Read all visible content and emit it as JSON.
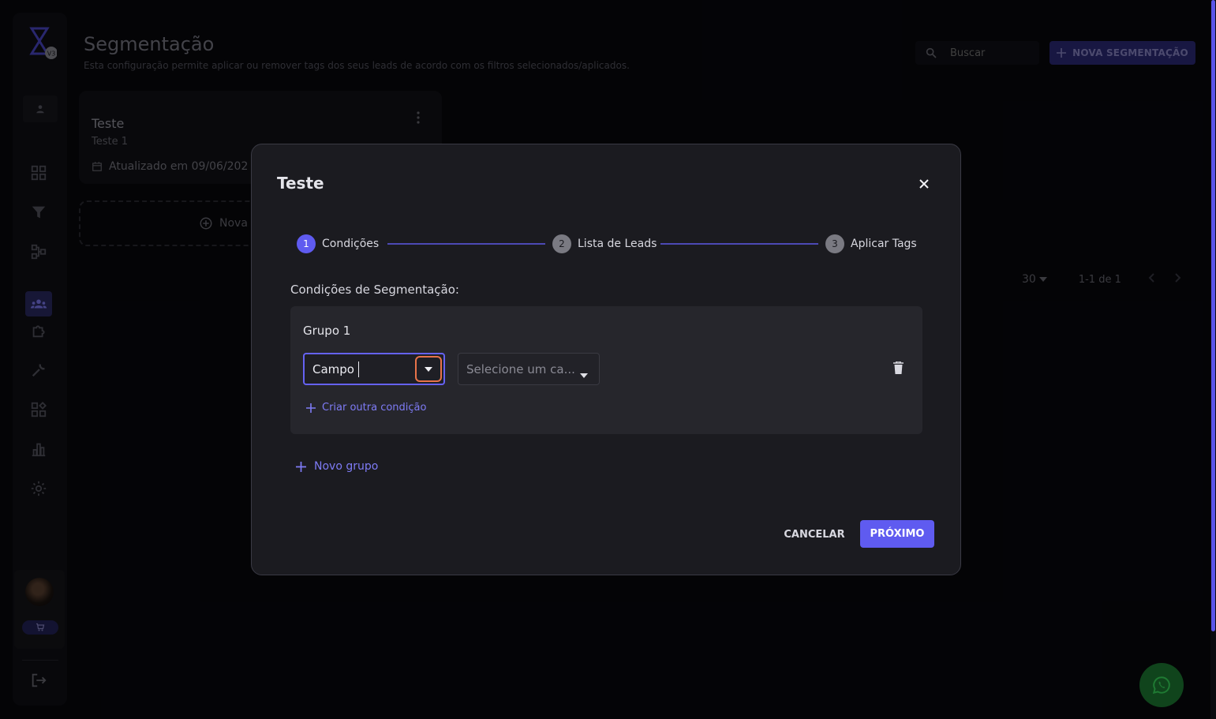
{
  "header": {
    "title": "Segmentação",
    "description": "Esta configuração permite aplicar ou remover tags dos seus leads de acordo com os filtros selecionados/aplicados.",
    "search_placeholder": "Buscar",
    "new_button": "NOVA SEGMENTAÇÃO"
  },
  "sidebar": {
    "logo_badge": "V3",
    "items": [
      {
        "icon": "dashboard-icon"
      },
      {
        "icon": "filter-icon"
      },
      {
        "icon": "flow-icon"
      },
      {
        "icon": "segmentation-icon",
        "active": true
      },
      {
        "icon": "puzzle-icon"
      },
      {
        "icon": "wrench-icon"
      },
      {
        "icon": "apps-icon"
      },
      {
        "icon": "chart-icon"
      },
      {
        "icon": "gear-icon"
      }
    ]
  },
  "card": {
    "title": "Teste",
    "subtitle": "Teste 1",
    "updated": "Atualizado em 09/06/202",
    "new_label": "Nova s"
  },
  "pagination": {
    "per_page": "30",
    "range": "1-1 de 1"
  },
  "modal": {
    "title": "Teste",
    "steps": [
      {
        "num": "1",
        "label": "Condições"
      },
      {
        "num": "2",
        "label": "Lista de Leads"
      },
      {
        "num": "3",
        "label": "Aplicar Tags"
      }
    ],
    "conditions_heading": "Condições de Segmentação:",
    "group_title": "Grupo 1",
    "field_value": "Campo",
    "condition_placeholder": "Selecione um ca...",
    "add_condition": "Criar outra condição",
    "add_group": "Novo grupo",
    "cancel": "CANCELAR",
    "next": "PRÓXIMO"
  },
  "colors": {
    "accent": "#5f5bf0",
    "focus_ring": "#e8734a",
    "whatsapp": "#10441c"
  }
}
